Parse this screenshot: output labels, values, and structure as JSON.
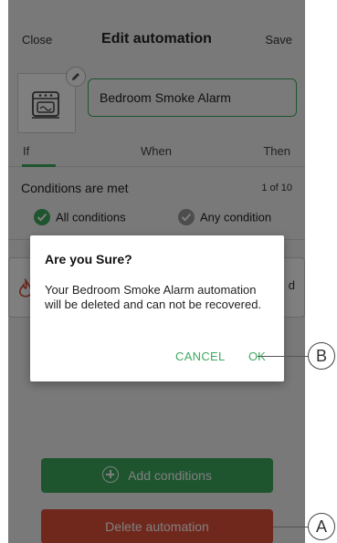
{
  "header": {
    "close_label": "Close",
    "title": "Edit automation",
    "save_label": "Save"
  },
  "automation": {
    "name": "Bedroom Smoke Alarm"
  },
  "tabs": [
    {
      "label": "If",
      "active": true
    },
    {
      "label": "When",
      "active": false
    },
    {
      "label": "Then",
      "active": false
    }
  ],
  "conditions": {
    "title": "Conditions are met",
    "count": "1 of 10",
    "options": [
      {
        "label": "All conditions",
        "selected": true
      },
      {
        "label": "Any condition",
        "selected": false
      }
    ],
    "card_tail": "d"
  },
  "buttons": {
    "add_conditions": "Add conditions",
    "delete_automation": "Delete automation"
  },
  "dialog": {
    "title": "Are you Sure?",
    "message": "Your Bedroom Smoke Alarm automation will be deleted and can not be recovered.",
    "cancel_label": "CANCEL",
    "ok_label": "OK"
  },
  "callouts": {
    "a": "A",
    "b": "B"
  },
  "colors": {
    "accent": "#3dab5f",
    "danger": "#e0513a",
    "background": "#f2f2f2"
  }
}
